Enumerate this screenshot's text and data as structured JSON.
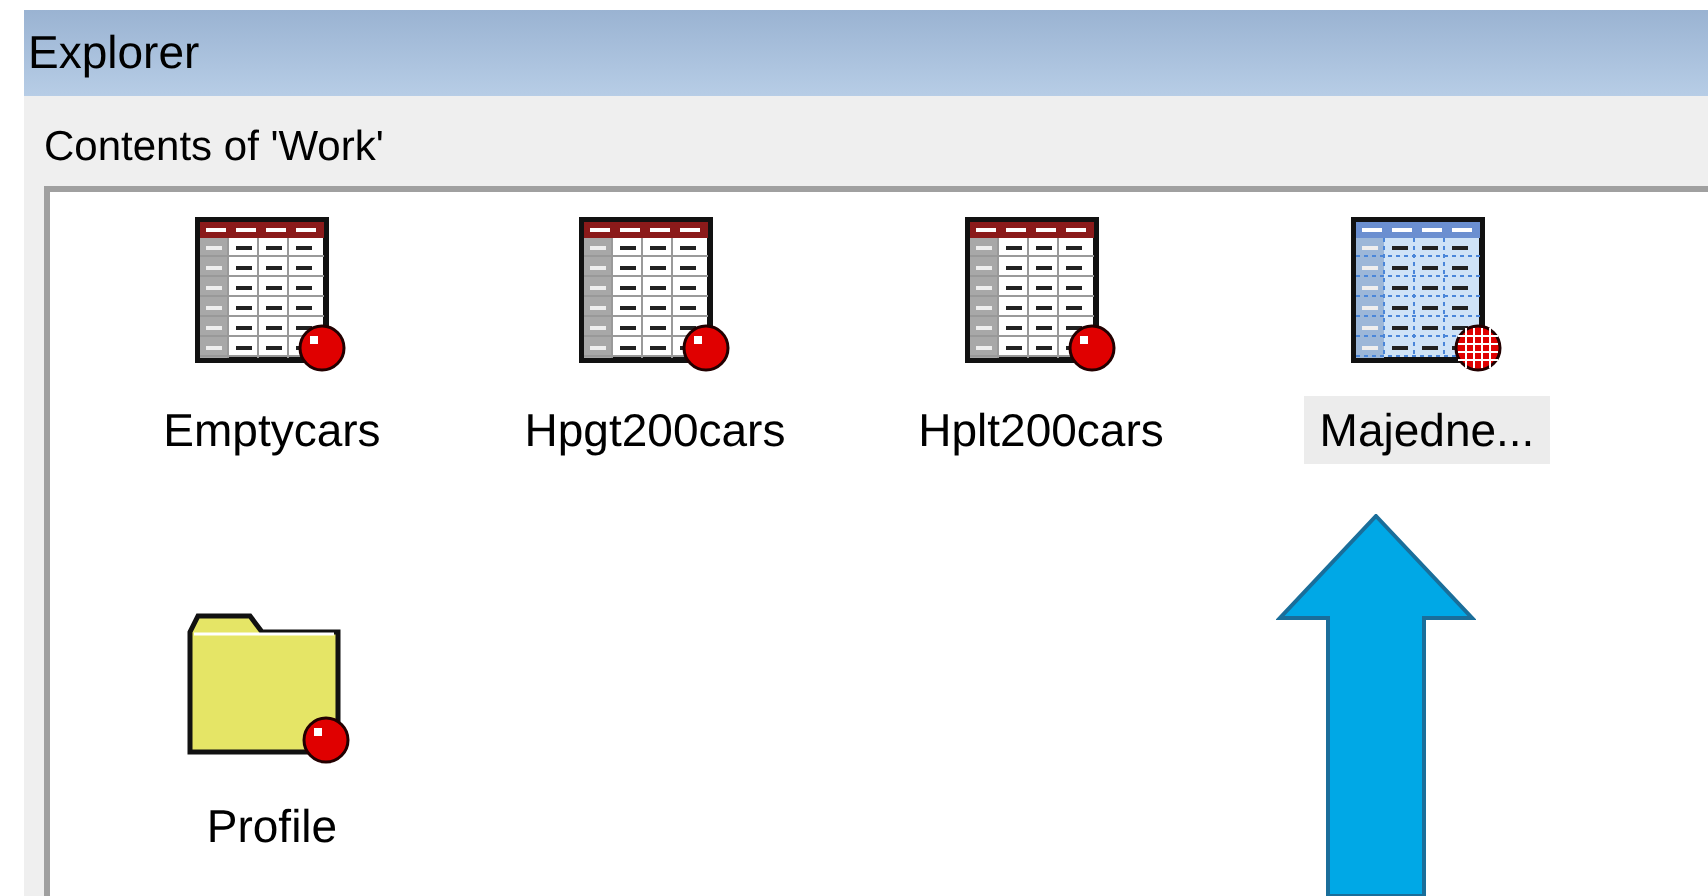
{
  "window": {
    "title": "Explorer"
  },
  "panel": {
    "title": "Contents of 'Work'"
  },
  "items": [
    {
      "label": "Emptycars",
      "kind": "table",
      "selected": false
    },
    {
      "label": "Hpgt200cars",
      "kind": "table",
      "selected": false
    },
    {
      "label": "Hplt200cars",
      "kind": "table",
      "selected": false
    },
    {
      "label": "Majedne...",
      "kind": "table",
      "selected": true
    },
    {
      "label": "Profile",
      "kind": "folder",
      "selected": false
    }
  ]
}
